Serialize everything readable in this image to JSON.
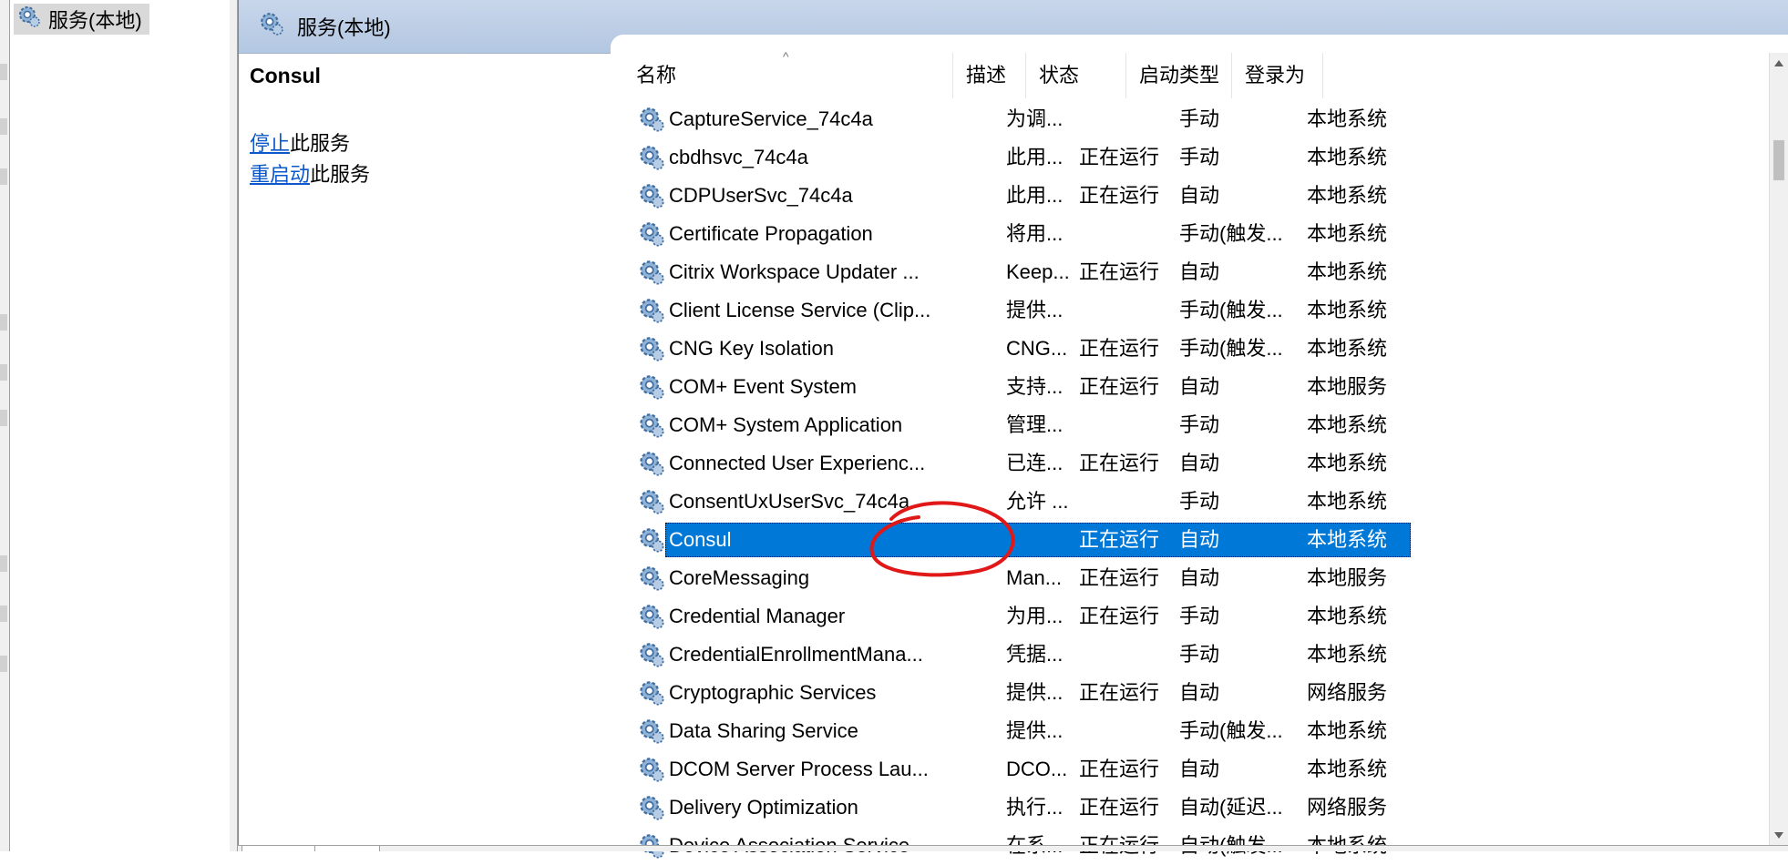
{
  "tree": {
    "root_label": "服务(本地)"
  },
  "pane": {
    "header_title": "服务(本地)",
    "selected_service_name": "Consul",
    "actions": [
      {
        "link": "停止",
        "suffix": "此服务"
      },
      {
        "link": "重启动",
        "suffix": "此服务"
      }
    ]
  },
  "columns": {
    "name": "名称",
    "desc": "描述",
    "state": "状态",
    "startup": "启动类型",
    "logon": "登录为"
  },
  "rows": [
    {
      "name": "CaptureService_74c4a",
      "desc": "为调...",
      "state": "",
      "startup": "手动",
      "logon": "本地系统"
    },
    {
      "name": "cbdhsvc_74c4a",
      "desc": "此用...",
      "state": "正在运行",
      "startup": "手动",
      "logon": "本地系统"
    },
    {
      "name": "CDPUserSvc_74c4a",
      "desc": "此用...",
      "state": "正在运行",
      "startup": "自动",
      "logon": "本地系统"
    },
    {
      "name": "Certificate Propagation",
      "desc": "将用...",
      "state": "",
      "startup": "手动(触发...",
      "logon": "本地系统"
    },
    {
      "name": "Citrix Workspace Updater ...",
      "desc": "Keep...",
      "state": "正在运行",
      "startup": "自动",
      "logon": "本地系统"
    },
    {
      "name": "Client License Service (Clip...",
      "desc": "提供...",
      "state": "",
      "startup": "手动(触发...",
      "logon": "本地系统"
    },
    {
      "name": "CNG Key Isolation",
      "desc": "CNG...",
      "state": "正在运行",
      "startup": "手动(触发...",
      "logon": "本地系统"
    },
    {
      "name": "COM+ Event System",
      "desc": "支持...",
      "state": "正在运行",
      "startup": "自动",
      "logon": "本地服务"
    },
    {
      "name": "COM+ System Application",
      "desc": "管理...",
      "state": "",
      "startup": "手动",
      "logon": "本地系统"
    },
    {
      "name": "Connected User Experienc...",
      "desc": "已连...",
      "state": "正在运行",
      "startup": "自动",
      "logon": "本地系统"
    },
    {
      "name": "ConsentUxUserSvc_74c4a",
      "desc": "允许 ...",
      "state": "",
      "startup": "手动",
      "logon": "本地系统"
    },
    {
      "name": "Consul",
      "desc": "",
      "state": "正在运行",
      "startup": "自动",
      "logon": "本地系统",
      "selected": true
    },
    {
      "name": "CoreMessaging",
      "desc": "Man...",
      "state": "正在运行",
      "startup": "自动",
      "logon": "本地服务"
    },
    {
      "name": "Credential Manager",
      "desc": "为用...",
      "state": "正在运行",
      "startup": "手动",
      "logon": "本地系统"
    },
    {
      "name": "CredentialEnrollmentMana...",
      "desc": "凭据...",
      "state": "",
      "startup": "手动",
      "logon": "本地系统"
    },
    {
      "name": "Cryptographic Services",
      "desc": "提供...",
      "state": "正在运行",
      "startup": "自动",
      "logon": "网络服务"
    },
    {
      "name": "Data Sharing Service",
      "desc": "提供...",
      "state": "",
      "startup": "手动(触发...",
      "logon": "本地系统"
    },
    {
      "name": "DCOM Server Process Lau...",
      "desc": "DCO...",
      "state": "正在运行",
      "startup": "自动",
      "logon": "本地系统"
    },
    {
      "name": "Delivery Optimization",
      "desc": "执行...",
      "state": "正在运行",
      "startup": "自动(延迟...",
      "logon": "网络服务"
    },
    {
      "name": "Device Association Service",
      "desc": "在系...",
      "state": "正在运行",
      "startup": "自动(触发...",
      "logon": "本地系统"
    }
  ],
  "colors": {
    "selection": "#0078d7",
    "header_band": "#b3c7e2",
    "annotation": "#e01818",
    "link": "#0a58ca"
  },
  "icons": {
    "service": "gear-icon"
  }
}
